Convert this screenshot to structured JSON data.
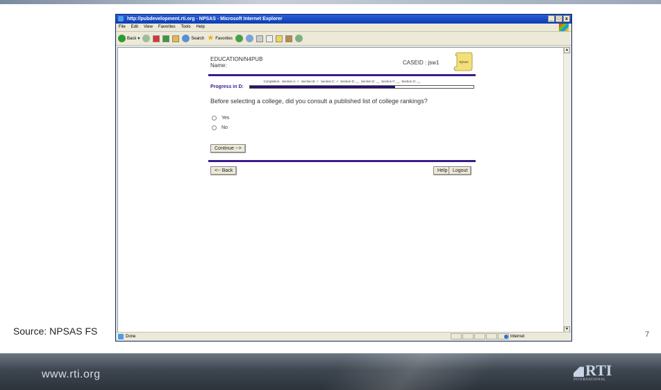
{
  "browser": {
    "title": "http://pubdevelopment.rti.org - NPSAS - Microsoft Internet Explorer",
    "window_buttons": [
      "_",
      "□",
      "x"
    ],
    "menu": [
      "File",
      "Edit",
      "View",
      "Favorites",
      "Tools",
      "Help"
    ],
    "toolbar": {
      "back": "Back",
      "search": "Search",
      "favorites": "Favorites"
    },
    "status": {
      "left": "Done",
      "zone": "Internet"
    }
  },
  "survey": {
    "study": "EDUCATION/N4PUB",
    "name_label": "Name:",
    "caseid": "CASEID : jsw1",
    "logo_text": "npsas",
    "completion": {
      "label": "Completion:",
      "sections": [
        {
          "label": "Section A:",
          "mark": "✓"
        },
        {
          "label": "Section B:",
          "mark": "✓"
        },
        {
          "label": "Section C:",
          "mark": "✓"
        },
        {
          "label": "Section D:",
          "mark": "__"
        },
        {
          "label": "Section E:",
          "mark": "__"
        },
        {
          "label": "Section F:",
          "mark": "__"
        },
        {
          "label": "Section G:",
          "mark": "__"
        }
      ]
    },
    "progress_label": "Progress in D:",
    "progress_fraction": 0.65,
    "question": "Before selecting a college, did you consult a published list of college rankings?",
    "options": [
      "Yes",
      "No"
    ],
    "continue_label": "Continue -->",
    "back_label": "<-- Back",
    "help_label": "Help",
    "logout_label": "Logout"
  },
  "slide": {
    "source": "Source:  NPSAS FS",
    "page_number": "7",
    "footer_url": "www.rti.org",
    "logo_text": "RTI",
    "logo_sub": "INTERNATIONAL"
  }
}
